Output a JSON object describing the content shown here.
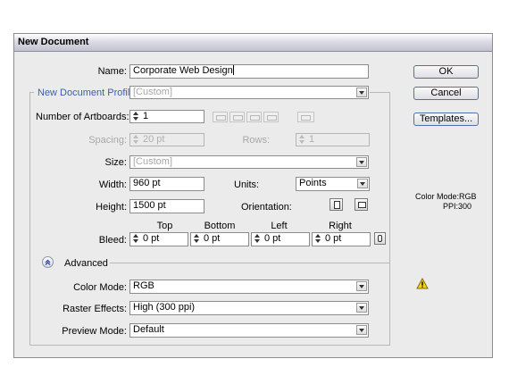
{
  "dialog": {
    "title": "New Document",
    "name_label": "Name:",
    "name_value": "Corporate Web Design",
    "profile_label": "New Document Profile:",
    "profile_value": "[Custom]",
    "artboards_label": "Number of Artboards:",
    "artboards_value": "1",
    "spacing_label": "Spacing:",
    "spacing_value": "20 pt",
    "rows_label": "Rows:",
    "rows_value": "1",
    "size_label": "Size:",
    "size_value": "[Custom]",
    "width_label": "Width:",
    "width_value": "960 pt",
    "units_label": "Units:",
    "units_value": "Points",
    "height_label": "Height:",
    "height_value": "1500 pt",
    "orientation_label": "Orientation:",
    "bleed_label": "Bleed:",
    "bleed_top_label": "Top",
    "bleed_top_value": "0 pt",
    "bleed_bottom_label": "Bottom",
    "bleed_bottom_value": "0 pt",
    "bleed_left_label": "Left",
    "bleed_left_value": "0 pt",
    "bleed_right_label": "Right",
    "bleed_right_value": "0 pt",
    "advanced_label": "Advanced",
    "color_mode_label": "Color Mode:",
    "color_mode_value": "RGB",
    "raster_label": "Raster Effects:",
    "raster_value": "High (300 ppi)",
    "preview_label": "Preview Mode:",
    "preview_value": "Default"
  },
  "buttons": {
    "ok": "OK",
    "cancel": "Cancel",
    "templates": "Templates..."
  },
  "info": {
    "color_mode": "Color Mode:RGB",
    "ppi": "PPI:300"
  },
  "colors": {
    "accent": "#3e5fa8",
    "warning": "#f2d21a"
  }
}
